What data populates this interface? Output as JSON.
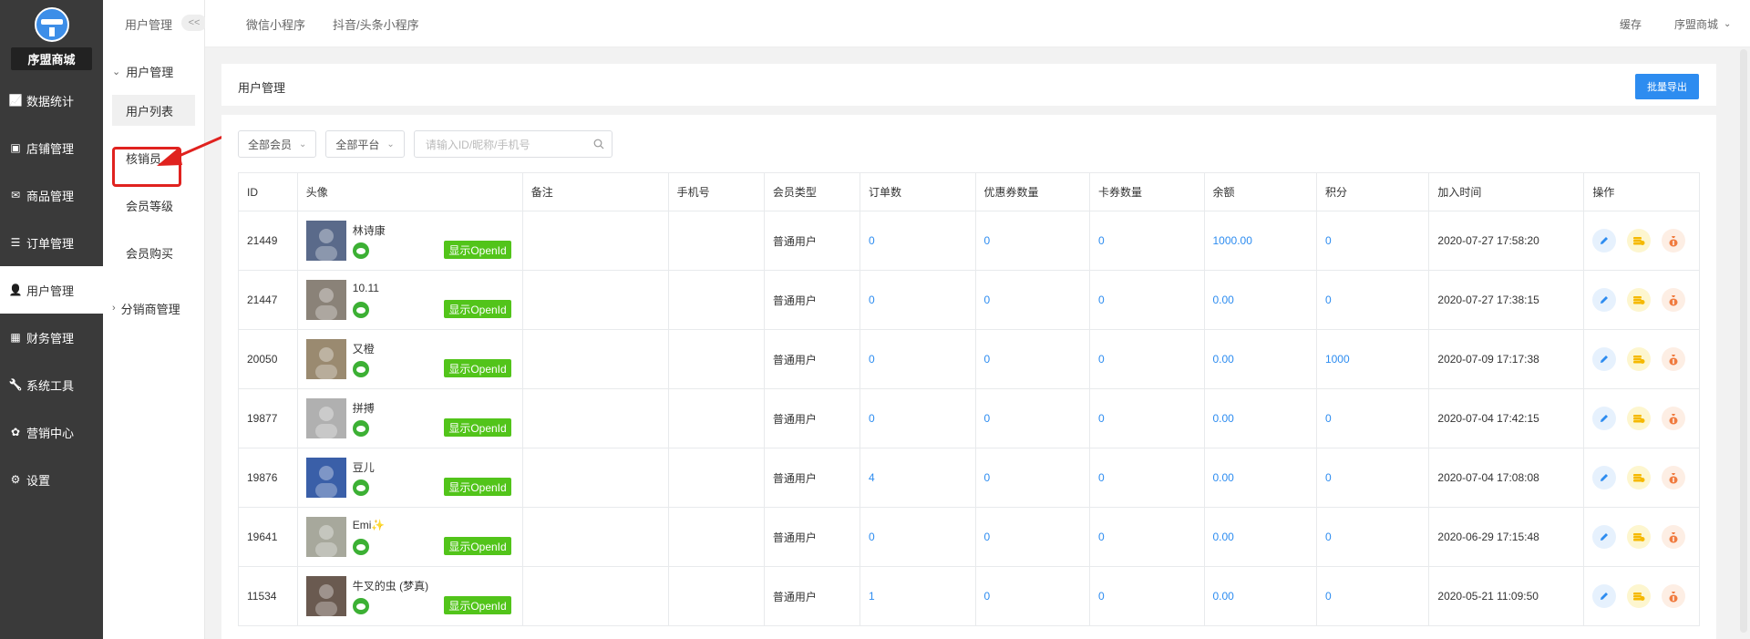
{
  "brand": {
    "name": "序盟商城"
  },
  "nav": [
    {
      "label": "数据统计",
      "icon": "chart-icon"
    },
    {
      "label": "店铺管理",
      "icon": "shop-icon"
    },
    {
      "label": "商品管理",
      "icon": "goods-icon"
    },
    {
      "label": "订单管理",
      "icon": "order-icon"
    },
    {
      "label": "用户管理",
      "icon": "user-icon",
      "active": true
    },
    {
      "label": "财务管理",
      "icon": "finance-icon"
    },
    {
      "label": "系统工具",
      "icon": "wrench-icon"
    },
    {
      "label": "营销中心",
      "icon": "marketing-icon"
    },
    {
      "label": "设置",
      "icon": "gear-icon"
    }
  ],
  "sub": {
    "title": "用户管理",
    "collapse": "<<",
    "group1": "用户管理",
    "items": [
      "用户列表",
      "核销员",
      "会员等级",
      "会员购买"
    ],
    "group2": "分销商管理"
  },
  "top": {
    "tabs": [
      "微信小程序",
      "抖音/头条小程序"
    ],
    "cache": "缓存",
    "user": "序盟商城"
  },
  "main": {
    "title": "用户管理",
    "export": "批量导出",
    "filters": {
      "member": "全部会员",
      "platform": "全部平台",
      "search_placeholder": "请输入ID/昵称/手机号"
    }
  },
  "table": {
    "headers": [
      "ID",
      "头像",
      "备注",
      "手机号",
      "会员类型",
      "订单数",
      "优惠券数量",
      "卡券数量",
      "余额",
      "积分",
      "加入时间",
      "操作"
    ],
    "openid_label": "显示OpenId",
    "rows": [
      {
        "id": "21449",
        "name": "林诗康",
        "remark": "",
        "phone": "",
        "type": "普通用户",
        "orders": "0",
        "coupons": "0",
        "cards": "0",
        "balance": "1000.00",
        "points": "0",
        "joined": "2020-07-27 17:58:20",
        "av": "#5a6a8a"
      },
      {
        "id": "21447",
        "name": "10.11",
        "remark": "",
        "phone": "",
        "type": "普通用户",
        "orders": "0",
        "coupons": "0",
        "cards": "0",
        "balance": "0.00",
        "points": "0",
        "joined": "2020-07-27 17:38:15",
        "av": "#8a8278"
      },
      {
        "id": "20050",
        "name": "又橙",
        "remark": "",
        "phone": "",
        "type": "普通用户",
        "orders": "0",
        "coupons": "0",
        "cards": "0",
        "balance": "0.00",
        "points": "1000",
        "joined": "2020-07-09 17:17:38",
        "av": "#9a8a70"
      },
      {
        "id": "19877",
        "name": "拼搏",
        "remark": "",
        "phone": "",
        "type": "普通用户",
        "orders": "0",
        "coupons": "0",
        "cards": "0",
        "balance": "0.00",
        "points": "0",
        "joined": "2020-07-04 17:42:15",
        "av": "#b0b0b0"
      },
      {
        "id": "19876",
        "name": "豆儿",
        "remark": "",
        "phone": "",
        "type": "普通用户",
        "orders": "4",
        "coupons": "0",
        "cards": "0",
        "balance": "0.00",
        "points": "0",
        "joined": "2020-07-04 17:08:08",
        "av": "#3a5fa8"
      },
      {
        "id": "19641",
        "name": "Emi✨",
        "remark": "",
        "phone": "",
        "type": "普通用户",
        "orders": "0",
        "coupons": "0",
        "cards": "0",
        "balance": "0.00",
        "points": "0",
        "joined": "2020-06-29 17:15:48",
        "av": "#a7a89c"
      },
      {
        "id": "11534",
        "name": "牛叉的虫 (梦真)",
        "remark": "",
        "phone": "",
        "type": "普通用户",
        "orders": "1",
        "coupons": "0",
        "cards": "0",
        "balance": "0.00",
        "points": "0",
        "joined": "2020-05-21 11:09:50",
        "av": "#6a5a50"
      }
    ]
  }
}
